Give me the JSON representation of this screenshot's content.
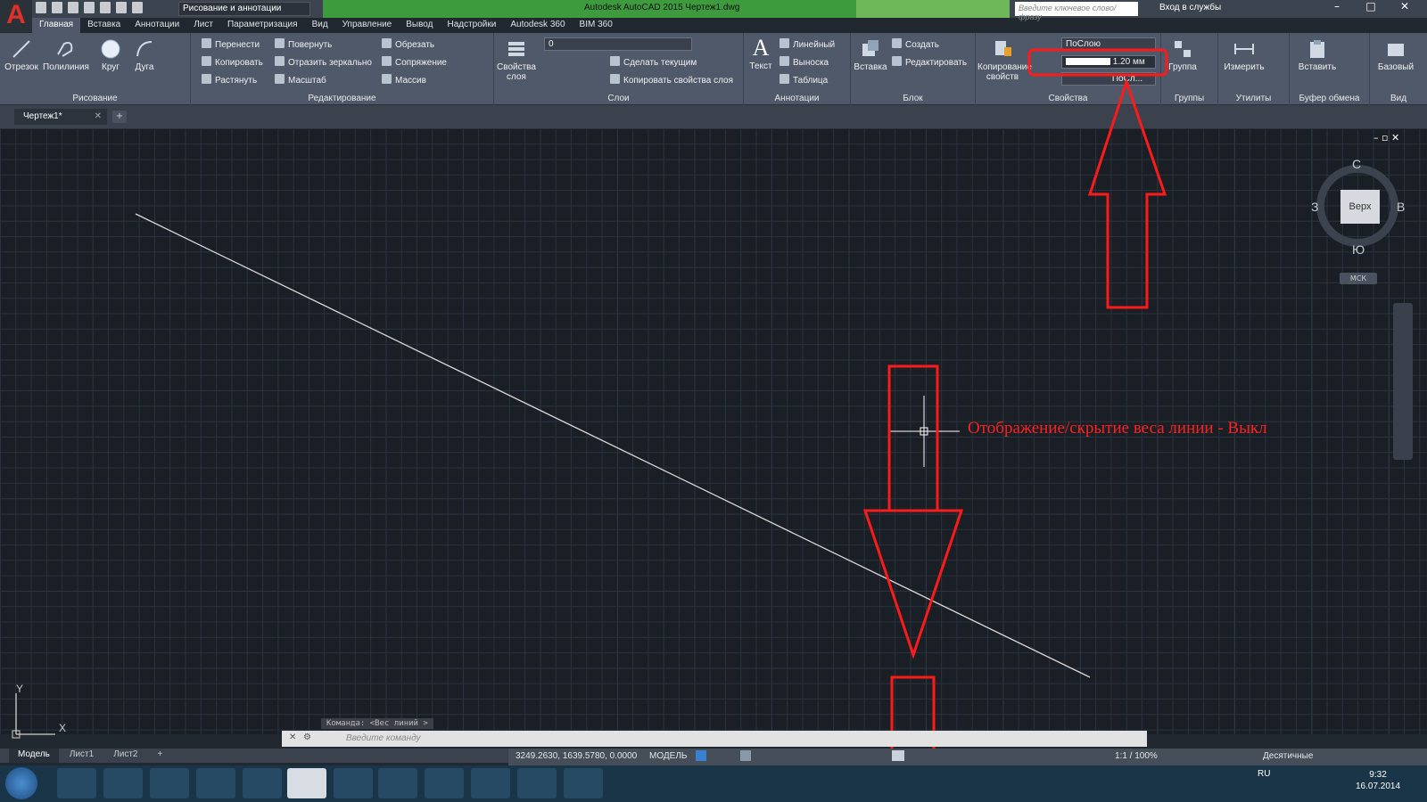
{
  "app": {
    "window_title": "Autodesk AutoCAD 2015    Чертеж1.dwg",
    "workspace": "Рисование и аннотации",
    "search_placeholder": "Введите ключевое слово/фразу",
    "sign_in": "Вход в службы"
  },
  "ribbon_tabs": [
    "Главная",
    "Вставка",
    "Аннотации",
    "Лист",
    "Параметризация",
    "Вид",
    "Управление",
    "Вывод",
    "Надстройки",
    "Autodesk 360",
    "BIM 360"
  ],
  "panels": {
    "draw": {
      "title": "Рисование",
      "line": "Отрезок",
      "polyline": "Полилиния",
      "circle": "Круг",
      "arc": "Дуга"
    },
    "modify": {
      "title": "Редактирование",
      "move": "Перенести",
      "rotate": "Повернуть",
      "trim": "Обрезать",
      "copy": "Копировать",
      "mirror": "Отразить зеркально",
      "fillet": "Сопряжение",
      "stretch": "Растянуть",
      "scale": "Масштаб",
      "array": "Массив"
    },
    "layers": {
      "title": "Слои",
      "layer_props": "Свойства слоя",
      "current_layer": "0",
      "make_current": "Сделать текущим",
      "match_layer": "Копировать свойства слоя"
    },
    "annotation": {
      "title": "Аннотации",
      "text": "Текст",
      "dimension": "Линейный",
      "leader": "Выноска",
      "table": "Таблица"
    },
    "block": {
      "title": "Блок",
      "insert": "Вставка",
      "create": "Создать",
      "edit": "Редактировать"
    },
    "properties": {
      "title": "Свойства",
      "match": "Копирование свойств",
      "color": "ПоСлою",
      "lineweight": "1.20 мм",
      "linetype": "ПоСл..."
    },
    "groups": {
      "title": "Группы",
      "group": "Группа"
    },
    "utilities": {
      "title": "Утилиты",
      "measure": "Измерить"
    },
    "clipboard": {
      "title": "Буфер обмена",
      "paste": "Вставить"
    },
    "view": {
      "title": "Вид",
      "base": "Базовый"
    }
  },
  "document_tab": "Чертеж1*",
  "viewcube": {
    "top": "Верх",
    "north": "С",
    "south": "Ю",
    "west": "З",
    "east": "В",
    "wcs": "МСК"
  },
  "command": {
    "history": "Команда:  <Вес линий >",
    "placeholder": "Введите команду"
  },
  "layout_tabs": [
    "Модель",
    "Лист1",
    "Лист2"
  ],
  "status": {
    "coords": "3249.2630, 1639.5780, 0.0000",
    "space": "МОДЕЛЬ",
    "scale": "1:1 / 100%",
    "units": "Десятичные"
  },
  "taskbar": {
    "lang": "RU",
    "time": "9:32",
    "date": "16.07.2014"
  },
  "annotation_text": "Отображение/скрытие веса линии - Выкл",
  "ucs": {
    "x": "X",
    "y": "Y"
  },
  "colors": {
    "accent_red": "#ff2020",
    "ribbon_bg": "#50596a",
    "canvas_bg": "#1a1f26",
    "title_green": "#3d9a3d"
  }
}
